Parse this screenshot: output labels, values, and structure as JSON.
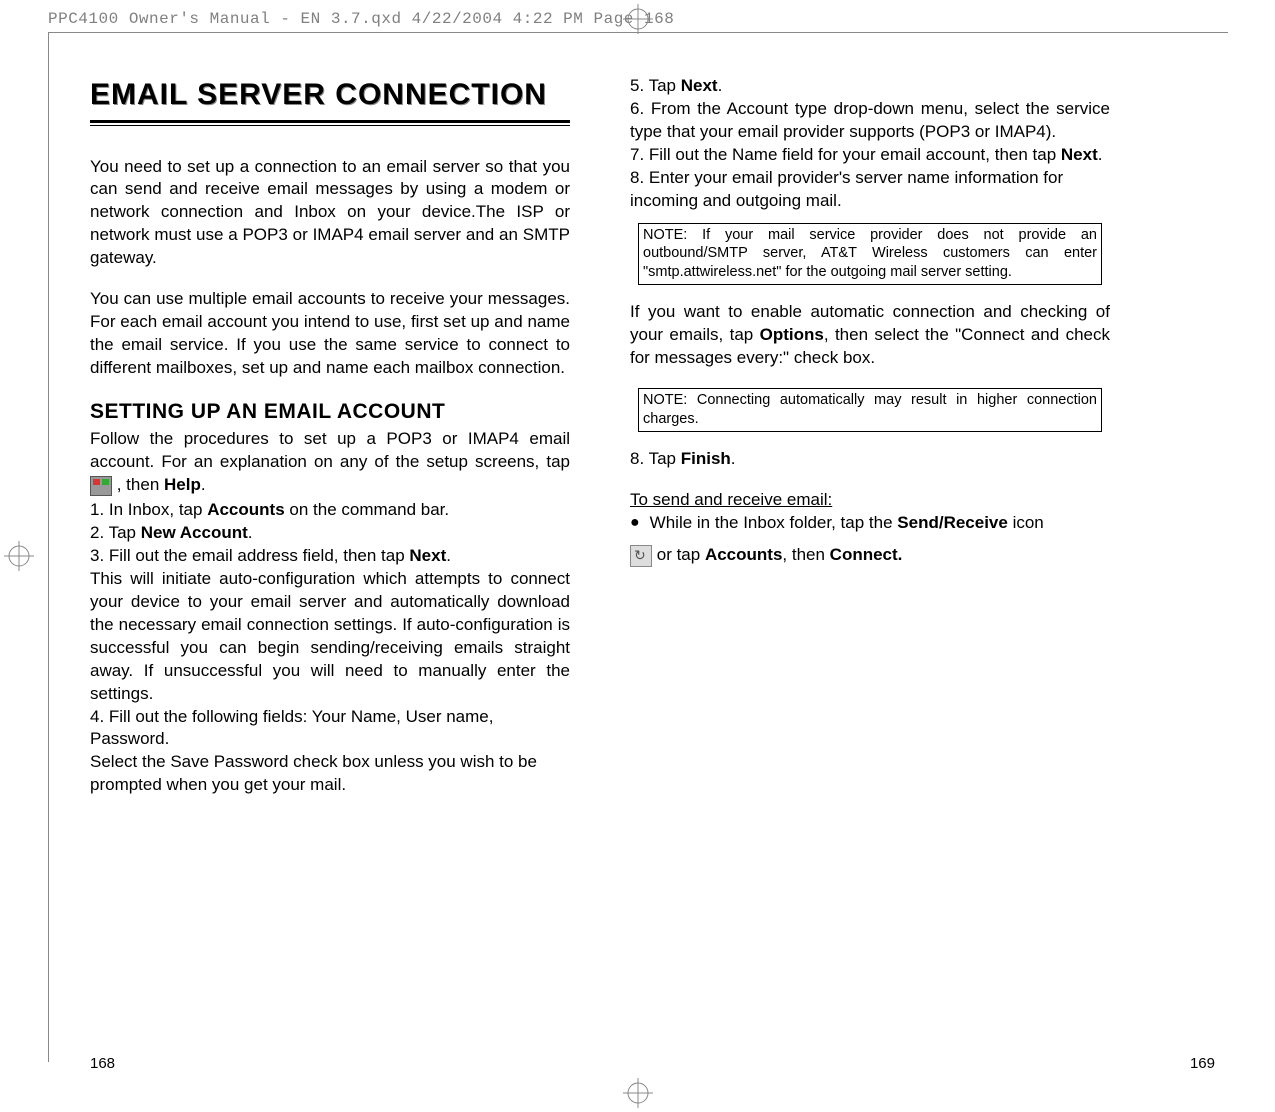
{
  "header": "PPC4100 Owner's Manual - EN 3.7.qxd  4/22/2004  4:22 PM  Page 168",
  "title": "EMAIL SERVER CONNECTION",
  "left": {
    "p1": "You need to set up a connection to an email server so that you can send and receive email messages by using a modem or network connection and Inbox on your device.The ISP or network must use a POP3 or IMAP4 email server and an SMTP gateway.",
    "p2": "You can use multiple email accounts to receive your messages. For each email account you intend to use, first set up and name the email service. If you use the same service to connect to different mailboxes, set up and name each mailbox connection.",
    "sub": "SETTING UP AN EMAIL ACCOUNT",
    "p3a": "Follow the procedures to set up a POP3 or IMAP4 email account. For an explanation on any of the setup screens, tap ",
    "p3b": ", then ",
    "help": "Help",
    "p3c": ".",
    "s1a": "1. In Inbox, tap ",
    "accounts": "Accounts",
    "s1b": " on the command bar.",
    "s2a": "2. Tap ",
    "newaccount": "New Account",
    "s2b": ".",
    "s3a": "3. Fill out the email address field, then tap ",
    "next": "Next",
    "s3b": ".",
    "p4": "This will initiate auto-configuration which attempts to connect your device to your email server and automatically download the necessary email connection settings. If auto-configuration is successful you can begin sending/receiving emails straight away. If unsuccessful you will need to manually enter the settings.",
    "s4": "4. Fill out the following fields: Your Name, User name, Password.",
    "p5": "Select the Save Password check box unless you wish to be prompted when you get your mail."
  },
  "right": {
    "s5a": "5. Tap ",
    "next": "Next",
    "s5b": ".",
    "s6": "6. From the Account type drop-down menu, select the service type that your email provider supports (POP3 or IMAP4).",
    "s7a": "7. Fill out the Name field for your email account, then tap ",
    "s7b": ".",
    "s8": "8. Enter your email provider's server name information for incoming and outgoing mail.",
    "note1": "NOTE: If your mail service provider does not provide an outbound/SMTP server, AT&T Wireless customers can enter \"smtp.attwireless.net\" for the outgoing mail server setting.",
    "p1a": "If you want to enable automatic connection and checking of your emails, tap ",
    "options": "Options",
    "p1b": ", then select the \"Connect and check for messages every:\" check box.",
    "note2": "NOTE: Connecting automatically may result in higher connection charges.",
    "s8f_a": "8. Tap ",
    "finish": "Finish",
    "s8f_b": ".",
    "u1": "To send and receive email:",
    "b1a": "While in the Inbox folder, tap the ",
    "sendreceive": "Send/Receive",
    "b1b": " icon",
    "b2a": " or tap ",
    "accounts": "Accounts",
    "b2b": ", then ",
    "connect": "Connect.",
    "b2c": ""
  },
  "pages": {
    "left": "168",
    "right": "169"
  }
}
